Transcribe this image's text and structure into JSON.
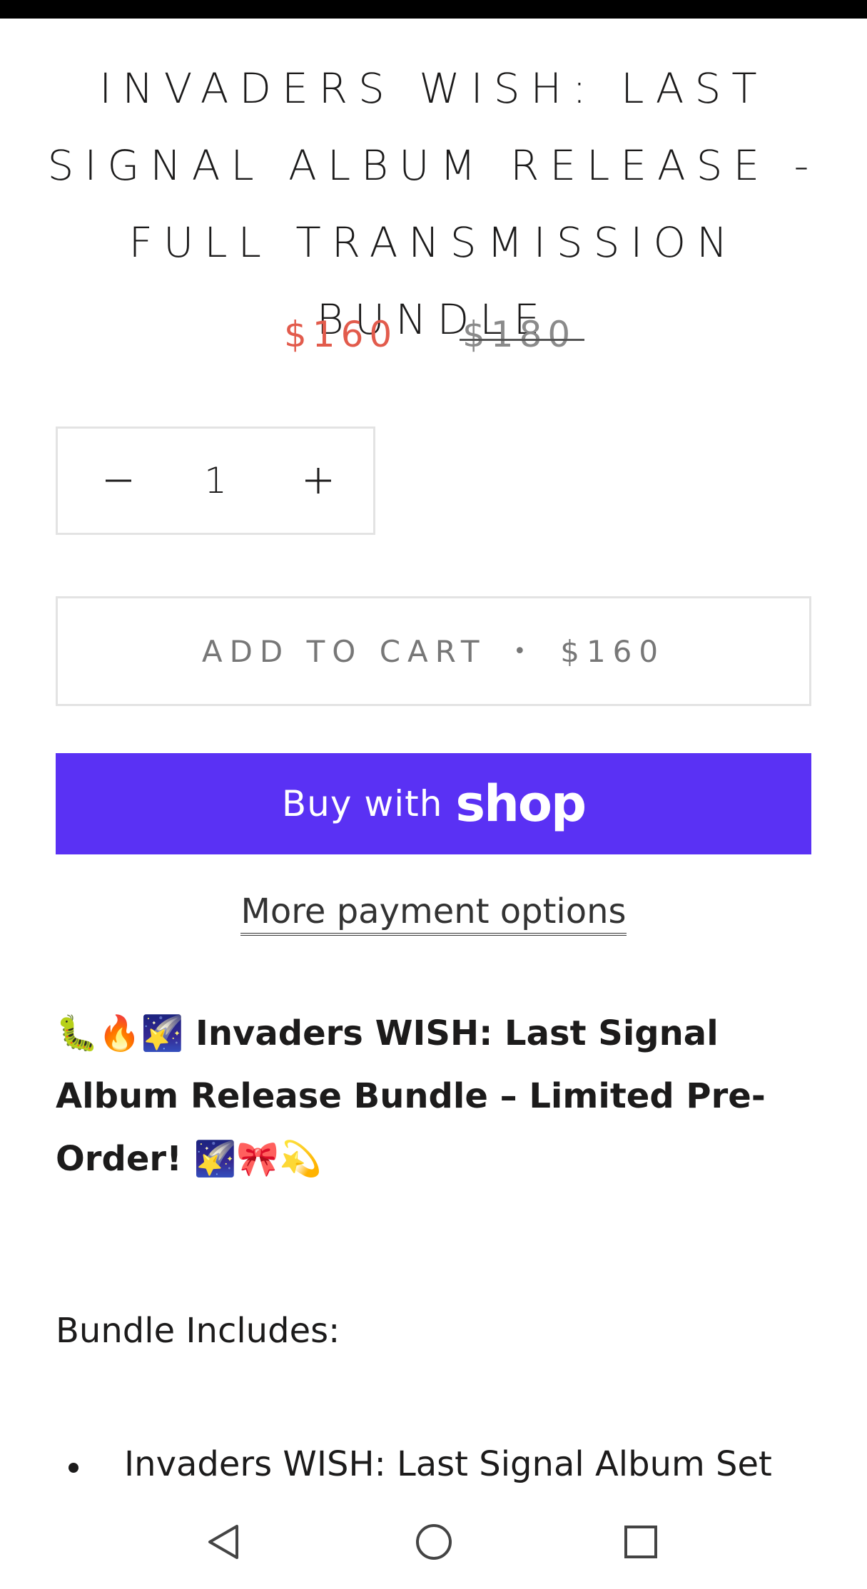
{
  "product": {
    "title": "INVADERS WISH: LAST SIGNAL ALBUM RELEASE - FULL TRANSMISSION BUNDLE",
    "price_sale": "$160",
    "price_compare": "$180"
  },
  "quantity": {
    "value": "1",
    "minus_icon": "minus-icon",
    "plus_icon": "plus-icon"
  },
  "cart": {
    "label": "ADD TO CART",
    "separator": "•",
    "price": "$160"
  },
  "shop_pay": {
    "buy_label": "Buy with",
    "brand": "shop",
    "color": "#5a31f4"
  },
  "more_payment_options": "More payment options",
  "description": {
    "headline": "🐛🔥🌠 Invaders WISH: Last Signal Album Release Bundle – Limited Pre-Order! 🌠🎀💫",
    "bundle_heading": "Bundle Includes:",
    "items": [
      "Invaders WISH: Last Signal Album Set"
    ]
  },
  "colors": {
    "sale_price": "#e25b4c",
    "text": "#1c1b1b",
    "border": "#e3e3e3"
  },
  "nav": {
    "back_icon": "back-triangle-icon",
    "home_icon": "home-circle-icon",
    "recents_icon": "recents-square-icon"
  }
}
